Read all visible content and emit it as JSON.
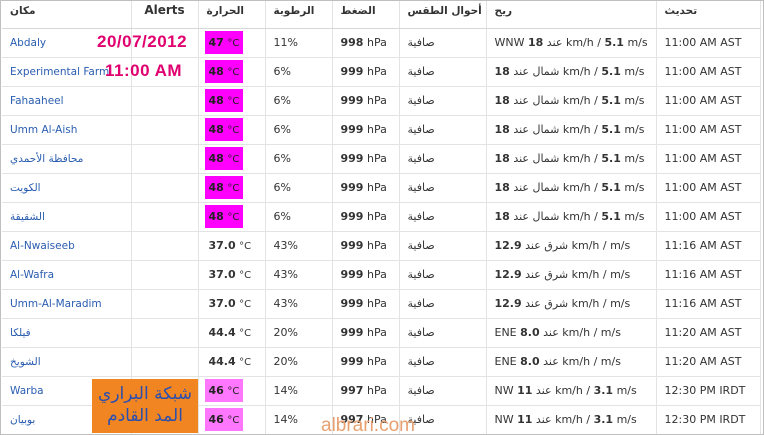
{
  "headers": {
    "place": "مكان",
    "alerts": "Alerts",
    "temp": "الحرارة",
    "humidity": "الرطوبة",
    "pressure": "الضغط",
    "conditions": "أحوال الطقس",
    "wind": "ريح",
    "updated": "تحديث"
  },
  "overlay": {
    "date": "20/07/2012",
    "time": "11:00 AM",
    "stamp_line1": "شبكة البراري",
    "stamp_line2": "المد القادم",
    "watermark": "albrari.com"
  },
  "colors": {
    "highlight_magenta": "#ff00ff",
    "highlight_pink": "#ff77ff",
    "overlay_text": "#e0006f",
    "link": "#2a5db0",
    "stamp_bg": "#f08522"
  },
  "rows": [
    {
      "place": "Abdaly",
      "temp": "47",
      "temp_unit": "°C",
      "humidity": "11%",
      "pressure": "998",
      "pressure_unit": "hPa",
      "cond": "صافية",
      "wind_pre": "WNW",
      "wind_speed": "18",
      "wind_mid": "عند km/h /",
      "wind_ms": "5.1",
      "wind_suffix": "m/s",
      "updated": "11:00 AM AST"
    },
    {
      "place": "Experimental Farm",
      "temp": "48",
      "temp_unit": "°C",
      "humidity": "6%",
      "pressure": "999",
      "pressure_unit": "hPa",
      "cond": "صافية",
      "wind_pre": "",
      "wind_speed": "18",
      "wind_mid": "شمال عند km/h /",
      "wind_ms": "5.1",
      "wind_suffix": "m/s",
      "updated": "11:00 AM AST"
    },
    {
      "place": "Fahaaheel",
      "temp": "48",
      "temp_unit": "°C",
      "humidity": "6%",
      "pressure": "999",
      "pressure_unit": "hPa",
      "cond": "صافية",
      "wind_pre": "",
      "wind_speed": "18",
      "wind_mid": "شمال عند km/h /",
      "wind_ms": "5.1",
      "wind_suffix": "m/s",
      "updated": "11:00 AM AST"
    },
    {
      "place": "Umm Al-Aish",
      "temp": "48",
      "temp_unit": "°C",
      "humidity": "6%",
      "pressure": "999",
      "pressure_unit": "hPa",
      "cond": "صافية",
      "wind_pre": "",
      "wind_speed": "18",
      "wind_mid": "شمال عند km/h /",
      "wind_ms": "5.1",
      "wind_suffix": "m/s",
      "updated": "11:00 AM AST"
    },
    {
      "place": "محافظة الأحمدي",
      "temp": "48",
      "temp_unit": "°C",
      "humidity": "6%",
      "pressure": "999",
      "pressure_unit": "hPa",
      "cond": "صافية",
      "wind_pre": "",
      "wind_speed": "18",
      "wind_mid": "شمال عند km/h /",
      "wind_ms": "5.1",
      "wind_suffix": "m/s",
      "updated": "11:00 AM AST"
    },
    {
      "place": "الكويت",
      "temp": "48",
      "temp_unit": "°C",
      "humidity": "6%",
      "pressure": "999",
      "pressure_unit": "hPa",
      "cond": "صافية",
      "wind_pre": "",
      "wind_speed": "18",
      "wind_mid": "شمال عند km/h /",
      "wind_ms": "5.1",
      "wind_suffix": "m/s",
      "updated": "11:00 AM AST"
    },
    {
      "place": "الشقيقة",
      "temp": "48",
      "temp_unit": "°C",
      "humidity": "6%",
      "pressure": "999",
      "pressure_unit": "hPa",
      "cond": "صافية",
      "wind_pre": "",
      "wind_speed": "18",
      "wind_mid": "شمال عند km/h /",
      "wind_ms": "5.1",
      "wind_suffix": "m/s",
      "updated": "11:00 AM AST"
    },
    {
      "place": "Al-Nwaiseeb",
      "temp": "37.0",
      "temp_unit": "°C",
      "humidity": "43%",
      "pressure": "999",
      "pressure_unit": "hPa",
      "cond": "صافية",
      "wind_pre": "",
      "wind_speed": "12.9",
      "wind_mid": "شرق عند km/h /",
      "wind_ms": "",
      "wind_suffix": "m/s",
      "updated": "11:16 AM AST"
    },
    {
      "place": "Al-Wafra",
      "temp": "37.0",
      "temp_unit": "°C",
      "humidity": "43%",
      "pressure": "999",
      "pressure_unit": "hPa",
      "cond": "صافية",
      "wind_pre": "",
      "wind_speed": "12.9",
      "wind_mid": "شرق عند km/h /",
      "wind_ms": "",
      "wind_suffix": "m/s",
      "updated": "11:16 AM AST"
    },
    {
      "place": "Umm-Al-Maradim",
      "temp": "37.0",
      "temp_unit": "°C",
      "humidity": "43%",
      "pressure": "999",
      "pressure_unit": "hPa",
      "cond": "صافية",
      "wind_pre": "",
      "wind_speed": "12.9",
      "wind_mid": "شرق عند km/h /",
      "wind_ms": "",
      "wind_suffix": "m/s",
      "updated": "11:16 AM AST"
    },
    {
      "place": "فيلكا",
      "temp": "44.4",
      "temp_unit": "°C",
      "humidity": "20%",
      "pressure": "999",
      "pressure_unit": "hPa",
      "cond": "صافية",
      "wind_pre": "ENE",
      "wind_speed": "8.0",
      "wind_mid": "عند km/h /",
      "wind_ms": "",
      "wind_suffix": "m/s",
      "updated": "11:20 AM AST"
    },
    {
      "place": "الشويخ",
      "temp": "44.4",
      "temp_unit": "°C",
      "humidity": "20%",
      "pressure": "999",
      "pressure_unit": "hPa",
      "cond": "صافية",
      "wind_pre": "ENE",
      "wind_speed": "8.0",
      "wind_mid": "عند km/h /",
      "wind_ms": "",
      "wind_suffix": "m/s",
      "updated": "11:20 AM AST"
    },
    {
      "place": "Warba",
      "temp": "46",
      "temp_unit": "°C",
      "humidity": "14%",
      "pressure": "997",
      "pressure_unit": "hPa",
      "cond": "صافية",
      "wind_pre": "NW",
      "wind_speed": "11",
      "wind_mid": "عند km/h /",
      "wind_ms": "3.1",
      "wind_suffix": "m/s",
      "updated": "12:30 PM IRDT"
    },
    {
      "place": "بوبيان",
      "temp": "46",
      "temp_unit": "°C",
      "humidity": "14%",
      "pressure": "997",
      "pressure_unit": "hPa",
      "cond": "صافية",
      "wind_pre": "NW",
      "wind_speed": "11",
      "wind_mid": "عند km/h /",
      "wind_ms": "3.1",
      "wind_suffix": "m/s",
      "updated": "12:30 PM IRDT"
    }
  ]
}
